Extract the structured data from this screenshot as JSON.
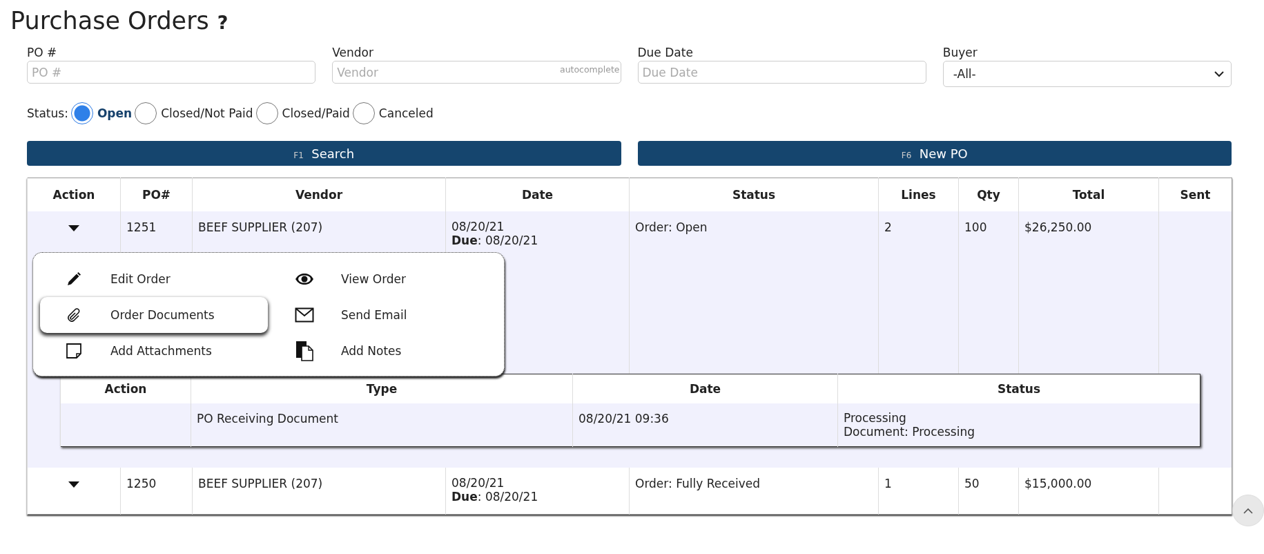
{
  "title": "Purchase Orders",
  "help": "?",
  "filters": [
    {
      "kind": "text",
      "label": "PO #",
      "placeholder": "PO #"
    },
    {
      "kind": "autocomplete",
      "label": "Vendor",
      "placeholder": "Vendor",
      "hint": "autocomplete"
    },
    {
      "kind": "text",
      "label": "Due Date",
      "placeholder": "Due Date"
    },
    {
      "kind": "select",
      "label": "Buyer",
      "value": "-All-"
    }
  ],
  "status": {
    "label": "Status:",
    "options": [
      {
        "label": "Open",
        "selected": true
      },
      {
        "label": "Closed/Not Paid",
        "selected": false
      },
      {
        "label": "Closed/Paid",
        "selected": false
      },
      {
        "label": "Canceled",
        "selected": false
      }
    ]
  },
  "buttons": [
    {
      "key": "F1",
      "label": "Search"
    },
    {
      "key": "F6",
      "label": "New PO"
    }
  ],
  "table": {
    "columns": [
      "Action",
      "PO#",
      "Vendor",
      "Date",
      "Status",
      "Lines",
      "Qty",
      "Total",
      "Sent"
    ],
    "rows": [
      {
        "expanded": true,
        "po": "1251",
        "vendor": "BEEF SUPPLIER (207)",
        "date": "08/20/21",
        "due": "**Due**: 08/20/21",
        "status": "Order: Open",
        "lines": "2",
        "qty": "100",
        "total": "$26,250.00"
      },
      {
        "expanded": false,
        "po": "1250",
        "vendor": "BEEF SUPPLIER (207)",
        "date": "08/20/21",
        "due": "**Due**: 08/20/21",
        "status": "Order: Fully Received",
        "lines": "1",
        "qty": "50",
        "total": "$15,000.00"
      }
    ]
  },
  "action_menu": {
    "items": [
      {
        "kind": "edit",
        "label": "Edit Order",
        "selected": false
      },
      {
        "kind": "view",
        "label": "View Order",
        "selected": false
      },
      {
        "kind": "documents",
        "label": "Order Documents",
        "selected": true
      },
      {
        "kind": "email",
        "label": "Send Email",
        "selected": false
      },
      {
        "kind": "attachments",
        "label": "Add Attachments",
        "selected": false
      },
      {
        "kind": "notes",
        "label": "Add Notes",
        "selected": false
      }
    ]
  },
  "documents": {
    "columns": [
      "Action",
      "Type",
      "Date",
      "Status"
    ],
    "rows": [
      {
        "type": "PO Receiving Document",
        "date": "08/20/21 09:36",
        "status": [
          "Processing",
          "Document: Processing"
        ]
      }
    ]
  }
}
